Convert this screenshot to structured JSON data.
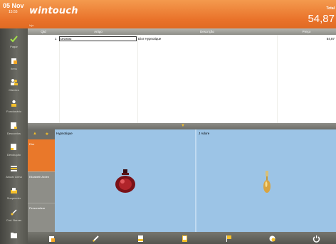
{
  "header": {
    "date": "05 Nov",
    "time": "15:55",
    "logo": "wintouch",
    "logo_sub": "loja",
    "total_label": "Total",
    "total_value": "54,87"
  },
  "sidebar": {
    "items": [
      {
        "label": "Pagar",
        "icon": "checkmark-icon"
      },
      {
        "label": "Itens",
        "icon": "items-icon"
      },
      {
        "label": "Clientes",
        "icon": "customers-icon"
      },
      {
        "label": "Funcionário",
        "icon": "employee-icon"
      },
      {
        "label": "Descontos",
        "icon": "discount-icon"
      },
      {
        "label": "Devolução",
        "icon": "return-icon"
      },
      {
        "label": "Anular Linha",
        "icon": "cancel-line-icon"
      },
      {
        "label": "Suspender",
        "icon": "suspend-icon"
      },
      {
        "label": "Cod. Barras",
        "icon": "barcode-icon"
      },
      {
        "label": "",
        "icon": "folder-icon"
      }
    ]
  },
  "grid": {
    "columns": [
      "Qtd",
      "Artigo",
      "Descrição",
      "Preço"
    ],
    "rows": [
      {
        "qty": "1",
        "article": "DIO002",
        "description": "Dior Hypnotique",
        "price": "54,87"
      }
    ]
  },
  "categories": {
    "items": [
      "Dior",
      "Elizabeth Arden",
      "Personalizar"
    ]
  },
  "products": [
    {
      "name": "Hypnotique",
      "icon": "perfume-bottle-red-icon"
    },
    {
      "name": "J Adore",
      "icon": "perfume-bottle-gold-icon"
    }
  ],
  "colors": {
    "accent": "#e9722a",
    "sidebar": "#5a5a54",
    "product_bg": "#9cc4e6"
  }
}
